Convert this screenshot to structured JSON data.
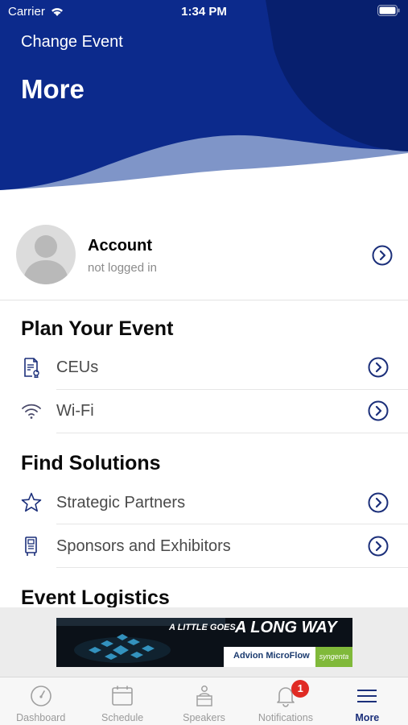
{
  "status_bar": {
    "carrier": "Carrier",
    "time": "1:34 PM"
  },
  "header": {
    "change_event": "Change Event",
    "title": "More"
  },
  "account": {
    "name": "Account",
    "status": "not logged in"
  },
  "sections": [
    {
      "title": "Plan Your Event",
      "items": [
        {
          "label": "CEUs",
          "icon": "certificate-icon"
        },
        {
          "label": "Wi-Fi",
          "icon": "wifi-icon"
        }
      ]
    },
    {
      "title": "Find Solutions",
      "items": [
        {
          "label": "Strategic Partners",
          "icon": "star-icon"
        },
        {
          "label": "Sponsors and Exhibitors",
          "icon": "booth-icon"
        }
      ]
    },
    {
      "title": "Event Logistics",
      "items": []
    }
  ],
  "ad": {
    "tagline": "A LITTLE GOES",
    "headline": "A LONG WAY",
    "brand": "Advion MicroFlow",
    "partner": "syngenta"
  },
  "tabs": [
    {
      "label": "Dashboard",
      "icon": "gauge-icon"
    },
    {
      "label": "Schedule",
      "icon": "calendar-icon"
    },
    {
      "label": "Speakers",
      "icon": "speaker-icon"
    },
    {
      "label": "Notifications",
      "icon": "bell-icon",
      "badge": "1"
    },
    {
      "label": "More",
      "icon": "menu-icon",
      "active": true
    }
  ],
  "colors": {
    "primary": "#0a2a8a",
    "accent_wave": "#7f95c8",
    "badge": "#e02b24",
    "active_tab": "#1b2f7a"
  }
}
